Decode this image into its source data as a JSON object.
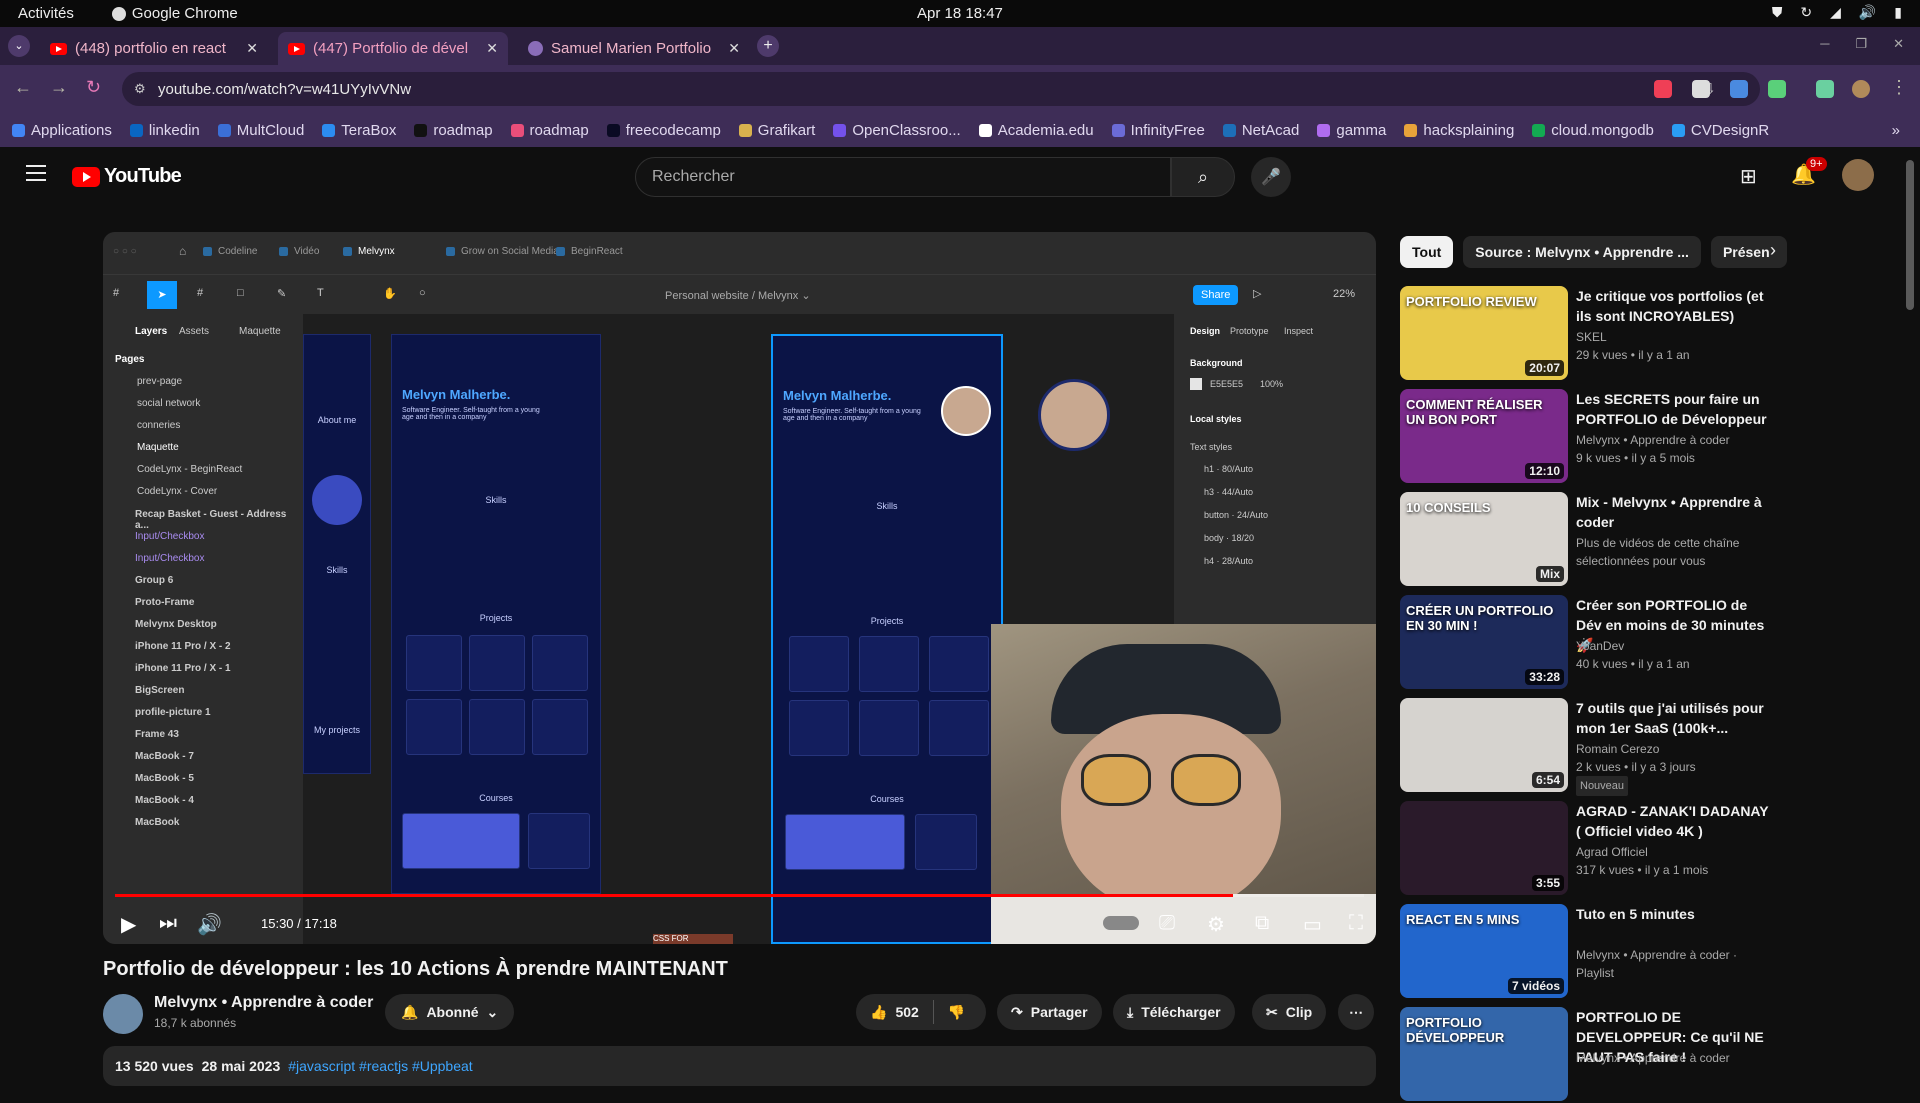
{
  "gnome": {
    "activities": "Activités",
    "app": "Google Chrome",
    "clock": "Apr 18  18:47"
  },
  "tabs": [
    {
      "label": "(448) portfolio en react"
    },
    {
      "label": "(447) Portfolio de dével"
    },
    {
      "label": "Samuel Marien Portfolio"
    }
  ],
  "url": "youtube.com/watch?v=w41UYyIvVNw",
  "bookmarks": [
    {
      "label": "Applications",
      "color": "#4285f4"
    },
    {
      "label": "linkedin",
      "color": "#0a66c2"
    },
    {
      "label": "MultCloud",
      "color": "#3b6fd6"
    },
    {
      "label": "TeraBox",
      "color": "#2c8cf0"
    },
    {
      "label": "roadmap",
      "color": "#111111"
    },
    {
      "label": "roadmap",
      "color": "#e94e7a"
    },
    {
      "label": "freecodecamp",
      "color": "#0a0a23"
    },
    {
      "label": "Grafikart",
      "color": "#d9b24e"
    },
    {
      "label": "OpenClassroo...",
      "color": "#7451eb"
    },
    {
      "label": "Academia.edu",
      "color": "#ffffff"
    },
    {
      "label": "InfinityFree",
      "color": "#6b6bd6"
    },
    {
      "label": "NetAcad",
      "color": "#1d6fb8"
    },
    {
      "label": "gamma",
      "color": "#b06cf0"
    },
    {
      "label": "hacksplaining",
      "color": "#e8a33a"
    },
    {
      "label": "cloud.mongodb",
      "color": "#13aa52"
    },
    {
      "label": "CVDesignR",
      "color": "#2a9df4"
    }
  ],
  "youtube": {
    "logo": "YouTube",
    "search_placeholder": "Rechercher",
    "notif_count": "9+"
  },
  "figma": {
    "tabs": [
      "Codeline",
      "Vidéo",
      "Melvynx",
      "Grow on Social Media",
      "BeginReact"
    ],
    "share": "Share",
    "zoom": "22%",
    "breadcrumb_file": "Personal website",
    "breadcrumb_page": "Melvynx",
    "left_tabs": [
      "Layers",
      "Assets",
      "Maquette"
    ],
    "pages_label": "Pages",
    "pages": [
      "prev-page",
      "social network",
      "conneries",
      "Maquette",
      "CodeLynx - BeginReact",
      "CodeLynx - Cover"
    ],
    "layers": [
      "Recap Basket - Guest - Address a...",
      "Input/Checkbox",
      "Input/Checkbox",
      "Group 6",
      "Proto-Frame",
      "Melvynx Desktop",
      "iPhone 11 Pro / X - 2",
      "iPhone 11 Pro / X - 1",
      "BigScreen",
      "profile-picture 1",
      "Frame 43",
      "MacBook - 7",
      "MacBook - 5",
      "MacBook - 4",
      "MacBook"
    ],
    "right_tabs": [
      "Design",
      "Prototype",
      "Inspect"
    ],
    "background_label": "Background",
    "background_value": "E5E5E5",
    "background_pct": "100%",
    "local_styles": "Local styles",
    "text_styles": "Text styles",
    "styles": [
      "h1 · 80/Auto",
      "h3 · 44/Auto",
      "button · 24/Auto",
      "body · 18/20",
      "h4 · 28/Auto"
    ],
    "frame_name": "Melvyn Malherbe.",
    "frame_sub": "Software Engineer. Self-taught from a young age and then in a company",
    "sections": [
      "Skills",
      "Projects",
      "Courses"
    ],
    "side_sections": [
      "About me",
      "Skills",
      "My projects"
    ],
    "course_badge": "CSS FOR JAVASCRIPT DEVELOPERS"
  },
  "player": {
    "time": "15:30 / 17:18",
    "progress": 0.895
  },
  "video": {
    "title": "Portfolio de développeur : les 10 Actions À prendre MAINTENANT",
    "channel": "Melvynx • Apprendre à coder",
    "subs": "18,7 k abonnés",
    "subscribed": "Abonné",
    "likes": "502",
    "share": "Partager",
    "download": "Télécharger",
    "clip": "Clip",
    "views": "13 520 vues",
    "date": "28 mai 2023",
    "tags": "#javascript #reactjs #Uppbeat"
  },
  "chips": [
    "Tout",
    "Source : Melvynx • Apprendre ...",
    "Présen"
  ],
  "recommendations": [
    {
      "title": "Je critique vos portfolios (et ils sont INCROYABLES)",
      "channel": "SKEL",
      "meta": "29 k vues  • il y a 1 an",
      "duration": "20:07",
      "thumb": "#e8c94a",
      "overlay": "PORTFOLIO REVIEW"
    },
    {
      "title": "Les SECRETS pour faire un PORTFOLIO de Développeur",
      "channel": "Melvynx • Apprendre à coder",
      "meta": "9 k vues  • il y a 5 mois",
      "duration": "12:10",
      "thumb": "#7a2a8a",
      "overlay": "COMMENT RÉALISER UN BON PORT"
    },
    {
      "title": "Mix - Melvynx • Apprendre à coder",
      "channel": "Plus de vidéos de cette chaîne sélectionnées pour vous",
      "meta": "",
      "duration": "Mix",
      "thumb": "#d8d4cf",
      "overlay": "10 CONSEILS"
    },
    {
      "title": "Créer son PORTFOLIO de Dév en moins de 30 minutes 🚀",
      "channel": "YoanDev",
      "meta": "40 k vues  • il y a 1 an",
      "duration": "33:28",
      "thumb": "#1d2a5a",
      "overlay": "CRÉER UN PORTFOLIO EN 30 MIN !"
    },
    {
      "title": "7 outils que j'ai utilisés pour mon 1er SaaS (100k+...",
      "channel": "Romain Cerezo",
      "meta": "2 k vues  • il y a 3 jours",
      "duration": "6:54",
      "thumb": "#d6d3cf",
      "overlay": "",
      "badge": "Nouveau"
    },
    {
      "title": "AGRAD - ZANAK'I DADANAY ( Officiel video 4K )",
      "channel": "Agrad Officiel",
      "meta": "317 k vues  • il y a 1 mois",
      "duration": "3:55",
      "thumb": "#2a1a2a",
      "overlay": ""
    },
    {
      "title": "Tuto en 5 minutes",
      "channel": "Melvynx • Apprendre à coder · Playlist",
      "meta": "",
      "duration": "7 vidéos",
      "thumb": "#2266cc",
      "overlay": "REACT EN 5 MINS"
    },
    {
      "title": "PORTFOLIO DE DEVELOPPEUR: Ce qu'il NE FAUT PAS faire !",
      "channel": "Melvynx • Apprendre à coder",
      "meta": "",
      "duration": "",
      "thumb": "#3366aa",
      "overlay": "PORTFOLIO DÉVELOPPEUR"
    }
  ]
}
